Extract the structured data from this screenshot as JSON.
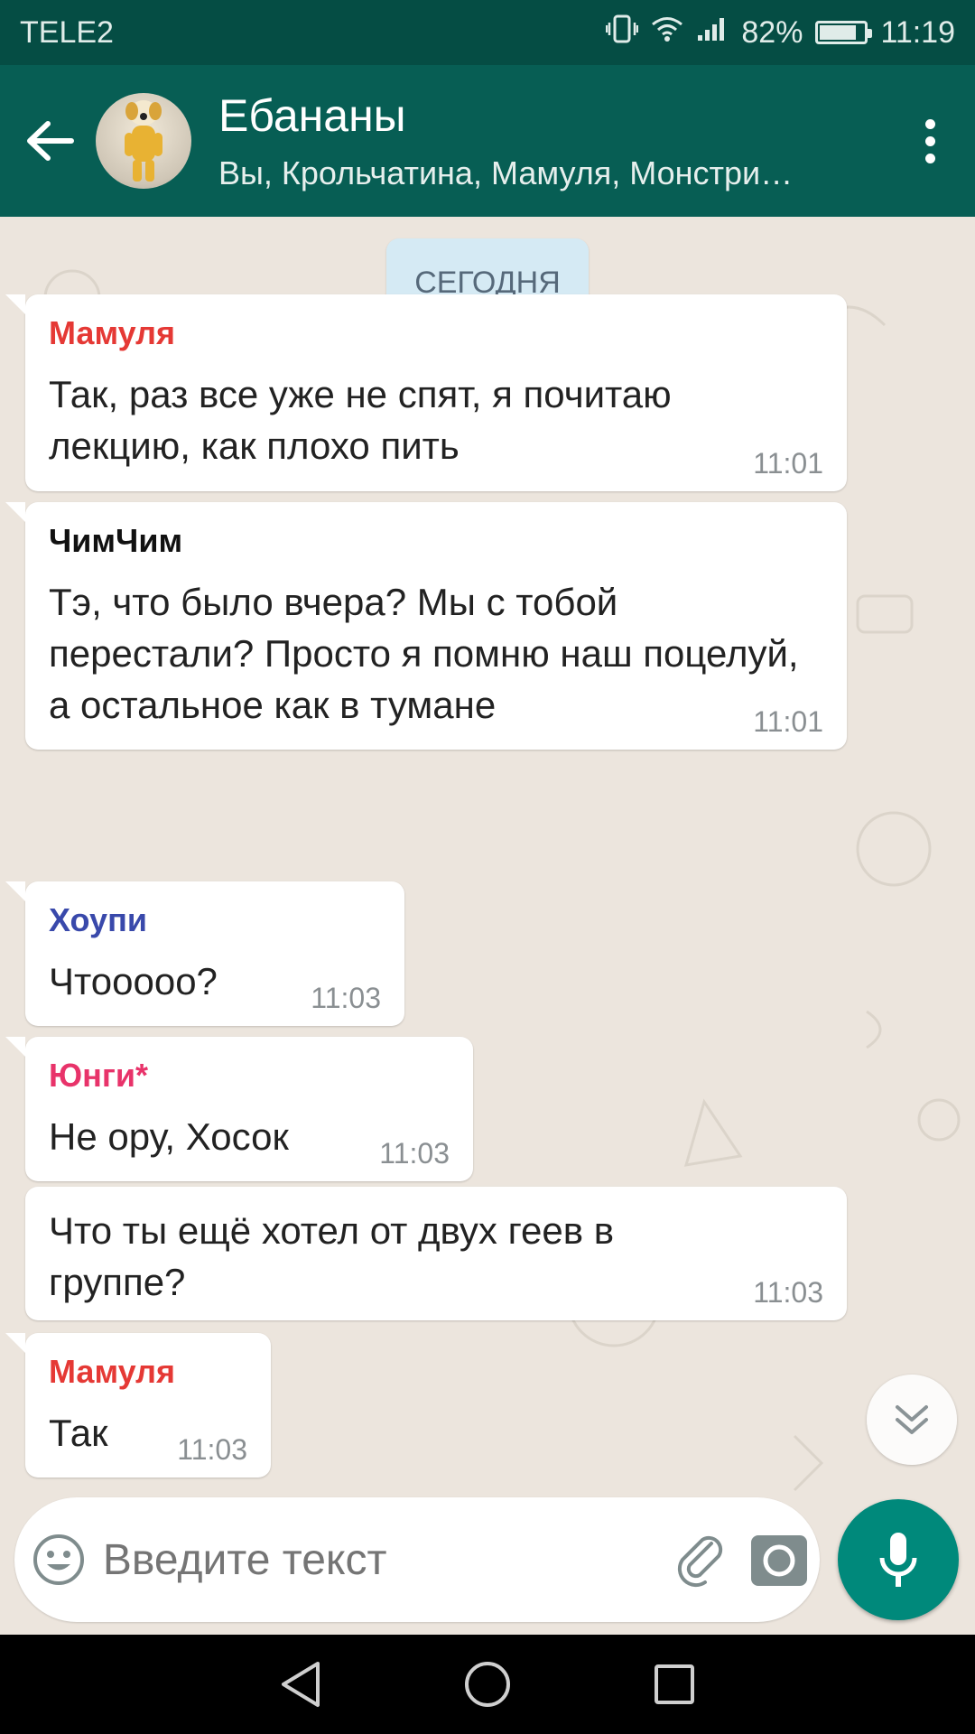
{
  "status_bar": {
    "carrier": "TELE2",
    "battery": "82%",
    "battery_level": 0.82,
    "time": "11:19"
  },
  "header": {
    "title": "Ебананы",
    "subtitle": "Вы, Крольчатина, Мамуля, Монстри…"
  },
  "chat": {
    "date_label": "СЕГОДНЯ",
    "messages": [
      {
        "sender": "Мамуля",
        "sender_color": "#e53935",
        "text": "Так, раз все уже не спят, я почитаю лекцию, как плохо пить",
        "time": "11:01"
      },
      {
        "sender": "ЧимЧим",
        "sender_color": "#111111",
        "text": "Тэ, что было вчера? Мы с тобой перестали? Просто я помню наш поцелуй, а остальное как в тумане",
        "time": "11:01"
      },
      {
        "sender": "Хоупи",
        "sender_color": "#3949ab",
        "text": "Чтооооо?",
        "time": "11:03"
      },
      {
        "sender": "Юнги*",
        "sender_color": "#e8336a",
        "text": "Не ору, Хосок",
        "time": "11:03"
      },
      {
        "sender": "",
        "text": "Что ты ещё хотел от двух геев в группе?",
        "time": "11:03"
      },
      {
        "sender": "Мамуля",
        "sender_color": "#e53935",
        "text": "Так",
        "time": "11:03"
      }
    ]
  },
  "input": {
    "placeholder": "Введите текст"
  },
  "icons": {
    "back": "arrow-left-icon",
    "menu": "more-vert-icon",
    "emoji": "emoji-icon",
    "attach": "paperclip-icon",
    "camera": "camera-icon",
    "mic": "mic-icon",
    "scroll_down": "chevron-double-down-icon"
  },
  "colors": {
    "header": "#075e54",
    "status_bar": "#054d44",
    "chat_background": "#ece5dd",
    "accent": "#00897b",
    "date_pill": "#d5eaf4"
  }
}
